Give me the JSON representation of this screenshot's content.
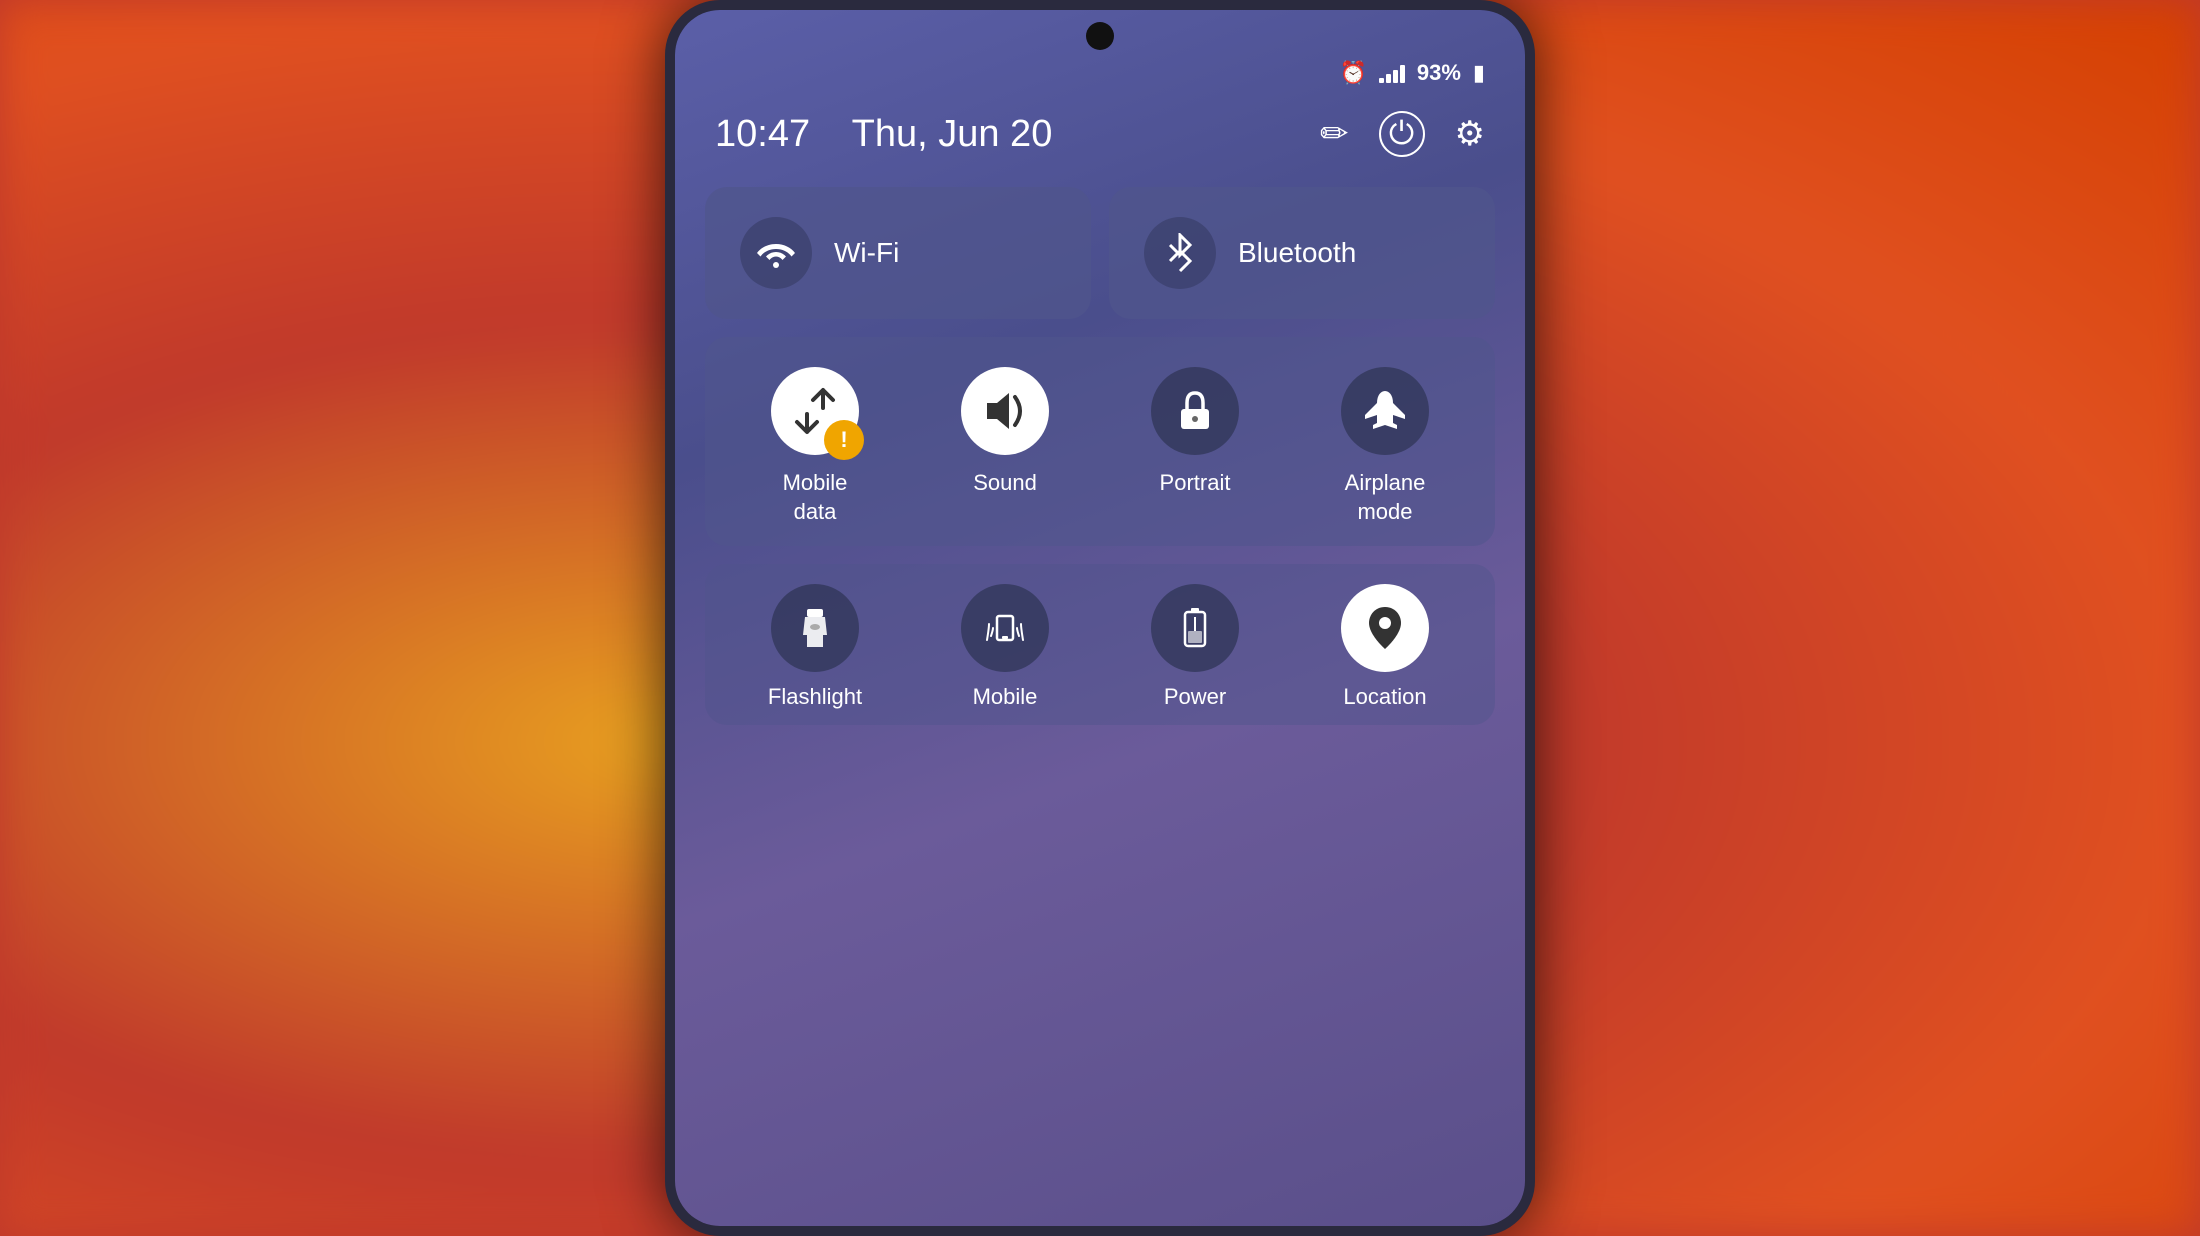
{
  "background": {
    "gradient": "radial orange-red blurred"
  },
  "phone": {
    "statusBar": {
      "alarm_icon": "⏰",
      "battery_percent": "93%",
      "battery_icon": "🔋"
    },
    "topBar": {
      "time": "10:47",
      "date": "Thu, Jun 20",
      "edit_icon": "✏️",
      "power_icon": "⏻",
      "settings_icon": "⚙"
    },
    "quickSettings": {
      "wifi": {
        "label": "Wi-Fi",
        "icon": "wifi"
      },
      "bluetooth": {
        "label": "Bluetooth",
        "icon": "bluetooth"
      },
      "grid_items": [
        {
          "id": "mobile-data",
          "label": "Mobile\ndata",
          "icon": "↕",
          "style": "white",
          "has_warning": true
        },
        {
          "id": "sound",
          "label": "Sound",
          "icon": "🔊",
          "style": "white",
          "has_warning": false
        },
        {
          "id": "portrait",
          "label": "Portrait",
          "icon": "🔒",
          "style": "dark",
          "has_warning": false
        },
        {
          "id": "airplane-mode",
          "label": "Airplane\nmode",
          "icon": "✈",
          "style": "dark",
          "has_warning": false
        }
      ],
      "bottom_items": [
        {
          "id": "flashlight",
          "label": "Flashlight",
          "icon": "🔦",
          "style": "dark"
        },
        {
          "id": "mobile-hotspot",
          "label": "Mobile",
          "icon": "📡",
          "style": "dark"
        },
        {
          "id": "power-saving",
          "label": "Power",
          "icon": "🔋",
          "style": "dark"
        },
        {
          "id": "location",
          "label": "Location",
          "icon": "📍",
          "style": "white"
        }
      ]
    }
  }
}
